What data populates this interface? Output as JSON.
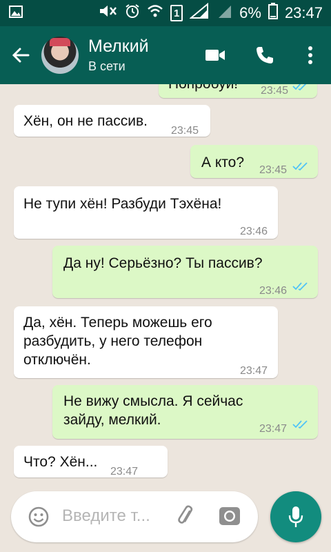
{
  "status_bar": {
    "battery_percent": "6%",
    "time": "23:47",
    "sim_slot": "1",
    "icons": [
      "image-icon",
      "mute-icon",
      "alarm-icon",
      "wifi-icon",
      "sim-icon",
      "signal-icon",
      "battery-icon"
    ]
  },
  "header": {
    "contact_name": "Мелкий",
    "status": "В сети",
    "icons": [
      "back-arrow-icon",
      "avatar",
      "video-call-icon",
      "phone-call-icon",
      "more-options-icon"
    ]
  },
  "messages": [
    {
      "dir": "out",
      "text": "Попробуй!",
      "time": "23:45",
      "read": true
    },
    {
      "dir": "in",
      "text": "Хён, он не пассив.",
      "time": "23:45"
    },
    {
      "dir": "out",
      "text": "А кто?",
      "time": "23:45",
      "read": true
    },
    {
      "dir": "in",
      "text": "Не тупи хён! Разбуди Тэхёна!",
      "time": "23:46"
    },
    {
      "dir": "out",
      "text": "Да ну! Серьёзно? Ты пассив?",
      "time": "23:46",
      "read": true
    },
    {
      "dir": "in",
      "lines": [
        "Да, хён. Теперь можешь его",
        "разбудить, у него телефон",
        "отключён."
      ],
      "time": "23:47"
    },
    {
      "dir": "out",
      "lines": [
        "Не вижу смысла. Я сейчас",
        "зайду, мелкий."
      ],
      "time": "23:47",
      "read": true
    },
    {
      "dir": "in",
      "text": "Что? Хён...",
      "time": "23:47"
    }
  ],
  "input": {
    "placeholder": "Введите т...",
    "icons": [
      "emoji-icon",
      "attach-icon",
      "camera-icon",
      "mic-icon"
    ]
  },
  "colors": {
    "status_bar": "#054d44",
    "app_bar": "#075e54",
    "outgoing_bubble": "#dcf8c6",
    "incoming_bubble": "#ffffff",
    "read_ticks": "#4fc3f7",
    "mic_button": "#128c7e"
  }
}
